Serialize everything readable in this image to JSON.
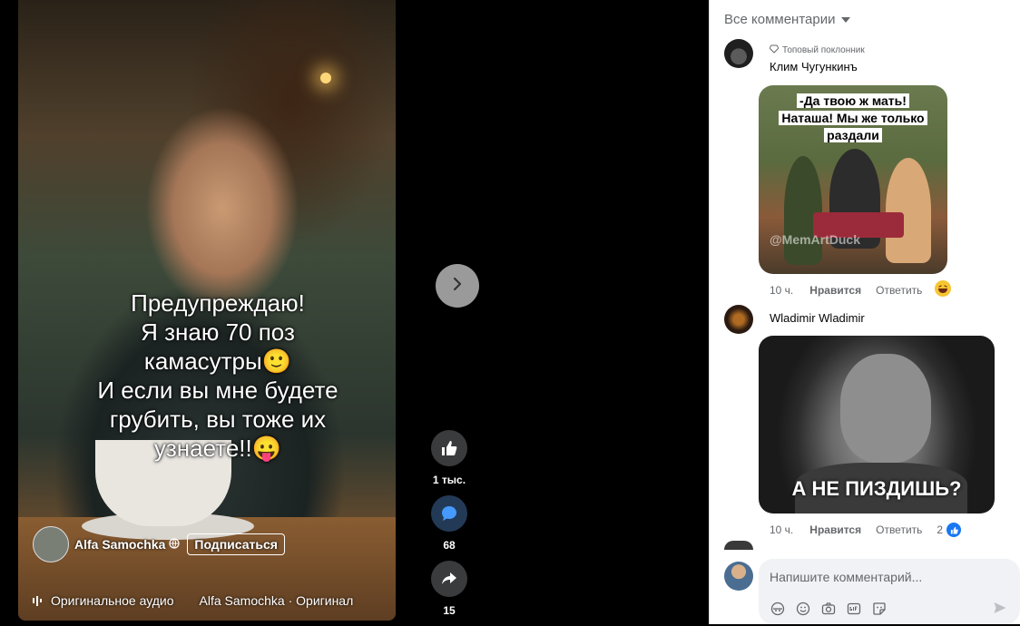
{
  "video": {
    "overlay_lines": [
      "Предупреждаю!",
      "Я знаю 70 поз",
      "камасутры🙂",
      "И если вы мне будете",
      "грубить, вы тоже их",
      "узнаете!!😛"
    ],
    "author_name": "Alfa Samochka",
    "subscribe_label": "Подписаться",
    "audio_label": "Оригинальное аудио",
    "audio_label2": "Alfa Samochka · Оригинал"
  },
  "actions": {
    "likes_count": "1 тыс.",
    "comments_count": "68",
    "shares_count": "15"
  },
  "comments_panel": {
    "sort_label": "Все комментарии",
    "comments": [
      {
        "badge": "Топовый поклонник",
        "author": "Клим Чугункинъ",
        "meme_caption": "-Да твою ж мать! Наташа! Мы же только раздали",
        "meme_caption_lines": [
          "-Да твою ж мать!",
          "Наташа! Мы же только",
          "раздали"
        ],
        "meme_watermark": "@MemArtDuck",
        "time": "10 ч.",
        "like_label": "Нравится",
        "reply_label": "Ответить"
      },
      {
        "author": "Wladimir Wladimir",
        "meme_caption": "А НЕ ПИЗДИШЬ?",
        "time": "10 ч.",
        "like_label": "Нравится",
        "reply_label": "Ответить",
        "reaction_count": "2"
      }
    ],
    "compose_placeholder": "Напишите комментарий..."
  },
  "colors": {
    "accent": "#1877f2",
    "panel_bg": "#ffffff",
    "stage_bg": "#000000"
  }
}
